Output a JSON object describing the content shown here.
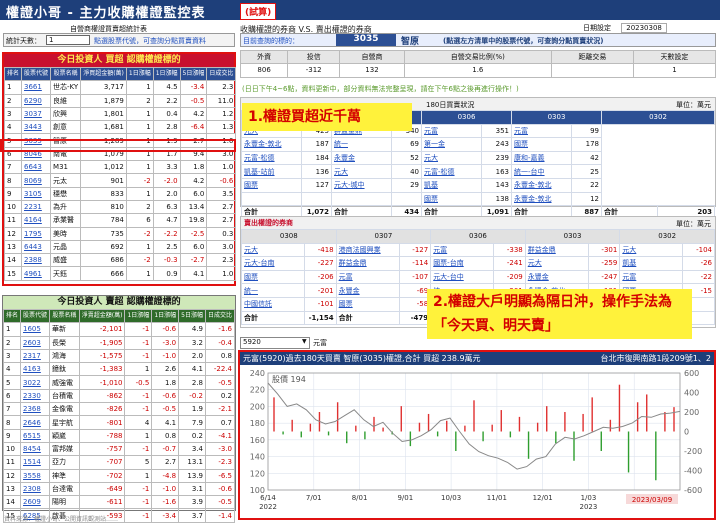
{
  "app": {
    "title": "權證小哥 - 主力收購權證監控表",
    "badge": "(試算)"
  },
  "header": {
    "subtitle": "自營商權證買賣超統計表",
    "right_title": "收購權證的券商 V.S. 賣出權證的券商",
    "date_label": "日期設定",
    "date": "20230308"
  },
  "controls": {
    "stat_days_label": "統計天數：",
    "stat_days_value": "1",
    "hint1": "點選股票代號，可查詢分點買賣資料",
    "target_label": "目前查詢的標的：",
    "stock_code": "3035",
    "stock_name": "智原",
    "hint2": "(點選左方清單中的股票代號，可查詢分點買賣狀況)"
  },
  "summary": {
    "headers": [
      "外資",
      "投信",
      "自營商",
      "自營交易比例(%)",
      "距離交易",
      "天數設定"
    ],
    "values": [
      "806",
      "-312",
      "132",
      "1.6",
      "",
      "1"
    ]
  },
  "notice": "(日日下午4~6點，資料更新中，部分資料無法完整呈現，請在下午6點之後再進行操作！)",
  "buy_section": {
    "title": "今日投資人 買超 認購權證標的",
    "headers": [
      "排名",
      "股票代號",
      "股票名稱",
      "淨買超金額(萬)",
      "1日漲幅",
      "5日漲幅",
      "日成交比"
    ],
    "rows": [
      [
        "1",
        "3661",
        "世芯-KY",
        "3,717",
        "1",
        "4.5",
        "-3.4",
        "2.3"
      ],
      [
        "2",
        "6290",
        "良維",
        "1,879",
        "2",
        "2.2",
        "-0.5",
        "11.0"
      ],
      [
        "3",
        "3037",
        "欣興",
        "1,801",
        "1",
        "0.4",
        "4.2",
        "1.2"
      ],
      [
        "4",
        "3443",
        "創意",
        "1,681",
        "1",
        "2.8",
        "-6.4",
        "1.3"
      ],
      [
        "5",
        "3035",
        "智原",
        "1,289",
        "1",
        "1.9",
        "2.7",
        "1.6"
      ],
      [
        "6",
        "8046",
        "南電",
        "1,079",
        "1",
        "1.7",
        "9.4",
        "3.0"
      ],
      [
        "7",
        "6643",
        "M31",
        "1,012",
        "1",
        "3.3",
        "1.8",
        "1.0"
      ],
      [
        "8",
        "8069",
        "元太",
        "901",
        "-2",
        "-2.0",
        "4.2",
        "-0.6"
      ],
      [
        "9",
        "3105",
        "穩懋",
        "833",
        "1",
        "2.0",
        "6.0",
        "3.5"
      ],
      [
        "10",
        "2231",
        "為升",
        "810",
        "2",
        "6.3",
        "13.4",
        "2.7"
      ],
      [
        "11",
        "4164",
        "承業醫",
        "784",
        "6",
        "4.7",
        "19.8",
        "2.7"
      ],
      [
        "12",
        "1795",
        "美時",
        "735",
        "-2",
        "-2.2",
        "-2.5",
        "0.3"
      ],
      [
        "13",
        "6443",
        "元晶",
        "692",
        "1",
        "2.5",
        "6.0",
        "3.0"
      ],
      [
        "14",
        "2388",
        "威盛",
        "686",
        "-2",
        "-0.3",
        "-2.7",
        "2.3"
      ],
      [
        "15",
        "4961",
        "天鈺",
        "666",
        "1",
        "0.9",
        "4.1",
        "1.0"
      ]
    ]
  },
  "sell_section": {
    "title": "今日投資人 賣超 認購權證標的",
    "headers": [
      "排名",
      "股票代號",
      "股票名稱",
      "淨賣超金額(萬)",
      "1日漲幅",
      "5日漲幅",
      "日成交比"
    ],
    "rows": [
      [
        "1",
        "1605",
        "華新",
        "-2,101",
        "-1",
        "-0.6",
        "4.9",
        "-1.6"
      ],
      [
        "2",
        "2603",
        "長榮",
        "-1,905",
        "-1",
        "-3.0",
        "3.2",
        "-0.4"
      ],
      [
        "3",
        "2317",
        "鴻海",
        "-1,575",
        "-1",
        "-1.0",
        "2.0",
        "0.8"
      ],
      [
        "4",
        "4163",
        "鐿鈦",
        "-1,383",
        "1",
        "2.6",
        "4.1",
        "-22.4"
      ],
      [
        "5",
        "3022",
        "威強電",
        "-1,010",
        "-0.5",
        "1.8",
        "2.8",
        "-0.5"
      ],
      [
        "6",
        "2330",
        "台積電",
        "-862",
        "-1",
        "-0.6",
        "-0.2",
        "0.2"
      ],
      [
        "7",
        "2368",
        "金像電",
        "-826",
        "-1",
        "-0.5",
        "1.9",
        "-2.1"
      ],
      [
        "8",
        "2646",
        "星宇航",
        "-801",
        "4",
        "4.1",
        "7.9",
        "0.7"
      ],
      [
        "9",
        "6515",
        "穎崴",
        "-788",
        "1",
        "0.8",
        "0.2",
        "-4.1"
      ],
      [
        "10",
        "8454",
        "富邦媒",
        "-757",
        "-1",
        "-0.7",
        "3.4",
        "-3.0"
      ],
      [
        "11",
        "1514",
        "亞力",
        "-707",
        "5",
        "2.7",
        "13.1",
        "-2.3"
      ],
      [
        "12",
        "3558",
        "神準",
        "-702",
        "1",
        "-4.8",
        "13.9",
        "-6.5"
      ],
      [
        "13",
        "2308",
        "台達電",
        "-649",
        "-1",
        "-1.0",
        "3.1",
        "-0.6"
      ],
      [
        "14",
        "2609",
        "陽明",
        "-611",
        "-1",
        "-1.6",
        "3.9",
        "-0.5"
      ],
      [
        "15",
        "6285",
        "啟碁",
        "-593",
        "-1",
        "-3.4",
        "3.7",
        "-1.4"
      ]
    ]
  },
  "buy_broker": {
    "title": "買進權證的券商",
    "subtitle": "180日買賣狀況",
    "unit": "單位：萬元",
    "dates": [
      "0307",
      "0306",
      "0303",
      "0302"
    ],
    "col0": [
      [
        "",
        "425"
      ],
      [
        "",
        "187"
      ],
      [
        "",
        "184"
      ],
      [
        "",
        "136"
      ],
      [
        "",
        "127"
      ]
    ],
    "rows": [
      [
        "元大",
        "425",
        "群益金鼎",
        "340",
        "元富",
        "351",
        "元富",
        "99"
      ],
      [
        "永豐金-敦北",
        "187",
        "統一",
        "69",
        "第一金",
        "243",
        "國票",
        "178"
      ],
      [
        "元富-松德",
        "184",
        "永豐金",
        "52",
        "元大",
        "239",
        "康和-嘉義",
        "42"
      ],
      [
        "凱基-站前",
        "136",
        "元大",
        "40",
        "元富-松德",
        "163",
        "統一-台中",
        "25"
      ],
      [
        "國票",
        "127",
        "元大-城中",
        "29",
        "凱基",
        "143",
        "永豐金-敦北",
        "22"
      ],
      [
        "",
        "",
        "",
        "",
        "國票",
        "138",
        "永豐金-敦北",
        "12"
      ],
      [
        "",
        "",
        "",
        "",
        "",
        "",
        "永豐金-新莊",
        "15"
      ]
    ],
    "totals": [
      "合計",
      "1,072",
      "合計",
      "434",
      "合計",
      "1,091",
      "合計",
      "887",
      "合計",
      "203"
    ]
  },
  "sell_broker": {
    "title": "賣出權證的券商",
    "unit": "單位：萬元",
    "dates": [
      "0308",
      "0307",
      "0306",
      "0303",
      "0302"
    ],
    "rows": [
      [
        "元大",
        "-418",
        "港商法國興業",
        "-127",
        "元富",
        "-338",
        "群益金鼎",
        "-301",
        "元大",
        "-104"
      ],
      [
        "元大-台南",
        "-227",
        "群益金鼎",
        "-114",
        "國票-台南",
        "-241",
        "元大",
        "-259",
        "凱基",
        "-26"
      ],
      [
        "國票",
        "-206",
        "元富",
        "-107",
        "元大-台中",
        "-209",
        "永豐金",
        "-247",
        "元富",
        "-22"
      ],
      [
        "統一",
        "-201",
        "永豐金",
        "-69",
        "統一",
        "-201",
        "永豐金-敦北",
        "-101",
        "國票",
        "-15"
      ],
      [
        "中國信託",
        "-101",
        "國票",
        "-58",
        "凱基",
        "-181",
        "",
        "",
        "",
        ""
      ]
    ],
    "totals": [
      "合計",
      "-1,154",
      "合計",
      "-479",
      "",
      "",
      "",
      "",
      "",
      ""
    ]
  },
  "callout1": "1.權證買超近千萬",
  "callout2": "2.權證大戶明顯為隔日沖，操作手法為「今天買、明天賣」",
  "chart_panel": {
    "selector_value": "5920",
    "selector_label": "元富",
    "caption": "元富(5920)過去180天買賣 智原(3035)權證,合計 買超 238.9萬元",
    "address": "台北市復興南路1段209號1、2",
    "price_label": "股價 194",
    "date_stamp": "2023/03/09",
    "footer": "資料來源：權證小哥、公開資訊觀測站……"
  },
  "chart_data": {
    "type": "bar",
    "title": "",
    "left_axis": {
      "ticks": [
        "240",
        "220",
        "200",
        "180",
        "160",
        "140",
        "120",
        "100"
      ],
      "range": [
        100,
        240
      ]
    },
    "right_axis": {
      "ticks": [
        "600",
        "400",
        "200",
        "0",
        "-200",
        "-400",
        "-600"
      ],
      "range": [
        -600,
        600
      ]
    },
    "x_ticks": [
      "6/14\n2022",
      "7/01",
      "8/01",
      "9/01",
      "10/03",
      "11/01",
      "12/01",
      "1/03\n2023",
      "2/01",
      ""
    ],
    "price_line": [
      228,
      215,
      200,
      203,
      196,
      184,
      179,
      182,
      189,
      196,
      184,
      176,
      181,
      168,
      158,
      160,
      165,
      172,
      183,
      186,
      170,
      155,
      146,
      141,
      138,
      133,
      125,
      128,
      137,
      140,
      155,
      163,
      161,
      165,
      170,
      175,
      174,
      176,
      180,
      188,
      187,
      191,
      192,
      194
    ],
    "bars": [
      350,
      -30,
      120,
      -60,
      80,
      200,
      -40,
      300,
      -120,
      60,
      -80,
      150,
      40,
      -30,
      260,
      -150,
      90,
      180,
      -50,
      110,
      -200,
      60,
      320,
      -100,
      70,
      220,
      -60,
      150,
      -280,
      90,
      260,
      -120,
      200,
      -300,
      180,
      350,
      -200,
      120,
      480,
      -420,
      300,
      380,
      -500,
      200,
      250
    ]
  },
  "colors": {
    "title_bg": "#1e3f7a",
    "accent_red": "#e01010",
    "callout_bg": "#fff23b",
    "header_blue": "#2c4f94",
    "header_green": "#2f6b2a"
  }
}
